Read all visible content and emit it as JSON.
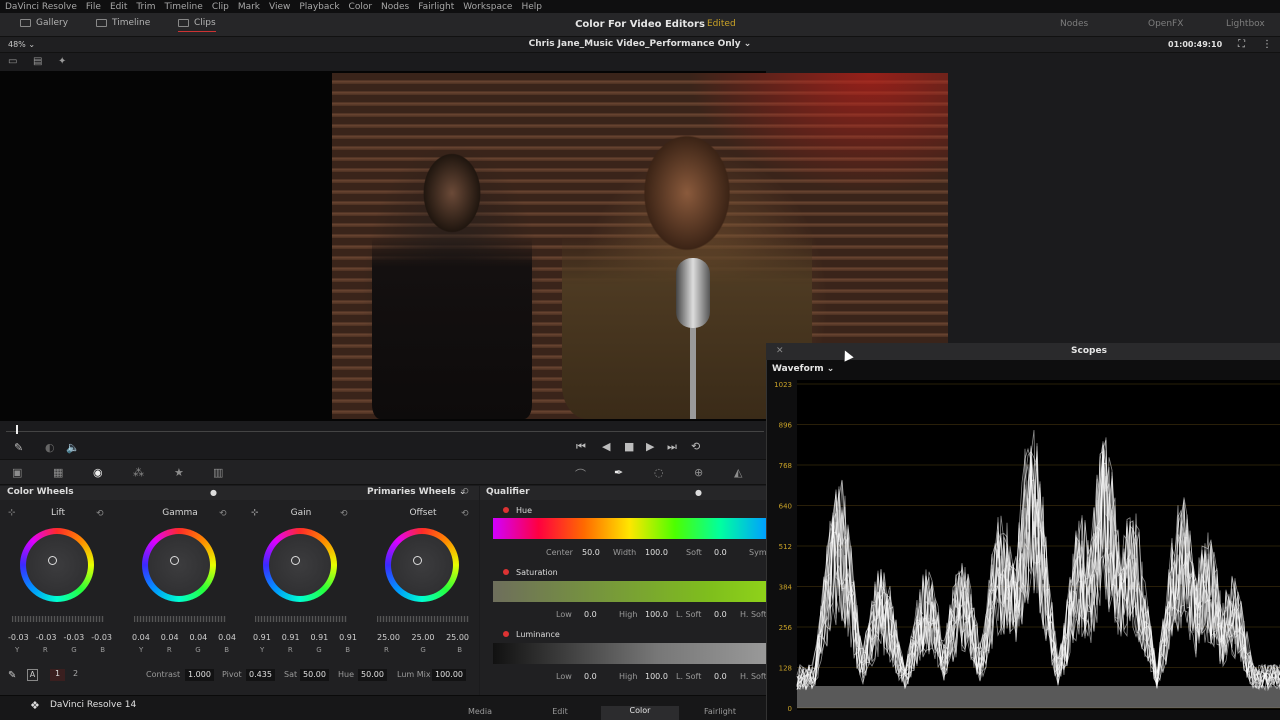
{
  "menubar": {
    "items": [
      "DaVinci Resolve",
      "File",
      "Edit",
      "Trim",
      "Timeline",
      "Clip",
      "Mark",
      "View",
      "Playback",
      "Color",
      "Nodes",
      "Fairlight",
      "Workspace",
      "Help"
    ]
  },
  "topbar": {
    "gallery": "Gallery",
    "timeline": "Timeline",
    "clips": "Clips",
    "project_title": "Color For Video Editors",
    "edited": "Edited",
    "nodes": "Nodes",
    "openfx": "OpenFX",
    "lightbox": "Lightbox"
  },
  "viewer": {
    "zoom": "48%",
    "clip_name": "Chris Jane_Music Video_Performance Only",
    "timecode": "01:00:49:10"
  },
  "color_wheels": {
    "title": "Color Wheels",
    "mode": "Primaries Wheels",
    "wheels": [
      {
        "label": "Lift",
        "values": [
          "-0.03",
          "-0.03",
          "-0.03",
          "-0.03"
        ],
        "channels": [
          "Y",
          "R",
          "G",
          "B"
        ]
      },
      {
        "label": "Gamma",
        "values": [
          "0.04",
          "0.04",
          "0.04",
          "0.04"
        ],
        "channels": [
          "Y",
          "R",
          "G",
          "B"
        ]
      },
      {
        "label": "Gain",
        "values": [
          "0.91",
          "0.91",
          "0.91",
          "0.91"
        ],
        "channels": [
          "Y",
          "R",
          "G",
          "B"
        ]
      },
      {
        "label": "Offset",
        "values": [
          "25.00",
          "25.00",
          "25.00"
        ],
        "channels": [
          "R",
          "G",
          "B"
        ]
      }
    ],
    "bottom": {
      "page1": "1",
      "page2": "2",
      "contrast_label": "Contrast",
      "contrast": "1.000",
      "pivot_label": "Pivot",
      "pivot": "0.435",
      "sat_label": "Sat",
      "sat": "50.00",
      "hue_label": "Hue",
      "hue": "50.00",
      "lummix_label": "Lum Mix",
      "lummix": "100.00"
    }
  },
  "qualifier": {
    "title": "Qualifier",
    "hue": {
      "label": "Hue",
      "center_label": "Center",
      "center": "50.0",
      "width_label": "Width",
      "width": "100.0",
      "soft_label": "Soft",
      "soft": "0.0",
      "sym_label": "Sym"
    },
    "saturation": {
      "label": "Saturation",
      "low_label": "Low",
      "low": "0.0",
      "high_label": "High",
      "high": "100.0",
      "lsoft_label": "L. Soft",
      "lsoft": "0.0",
      "hsoft_label": "H. Soft"
    },
    "luminance": {
      "label": "Luminance",
      "low_label": "Low",
      "low": "0.0",
      "high_label": "High",
      "high": "100.0",
      "lsoft_label": "L. Soft",
      "lsoft": "0.0",
      "hsoft_label": "H. Soft"
    }
  },
  "scopes": {
    "title": "Scopes",
    "type": "Waveform",
    "ticks": [
      "1023",
      "896",
      "768",
      "640",
      "512",
      "384",
      "256",
      "128",
      "0"
    ]
  },
  "footer": {
    "brand": "DaVinci Resolve 14",
    "tabs": [
      "Media",
      "Edit",
      "Color",
      "Fairlight"
    ],
    "active": "Color"
  },
  "colors": {
    "accent": "#c33333",
    "edited": "#c9a227",
    "scope_line": "#b58a2a"
  }
}
